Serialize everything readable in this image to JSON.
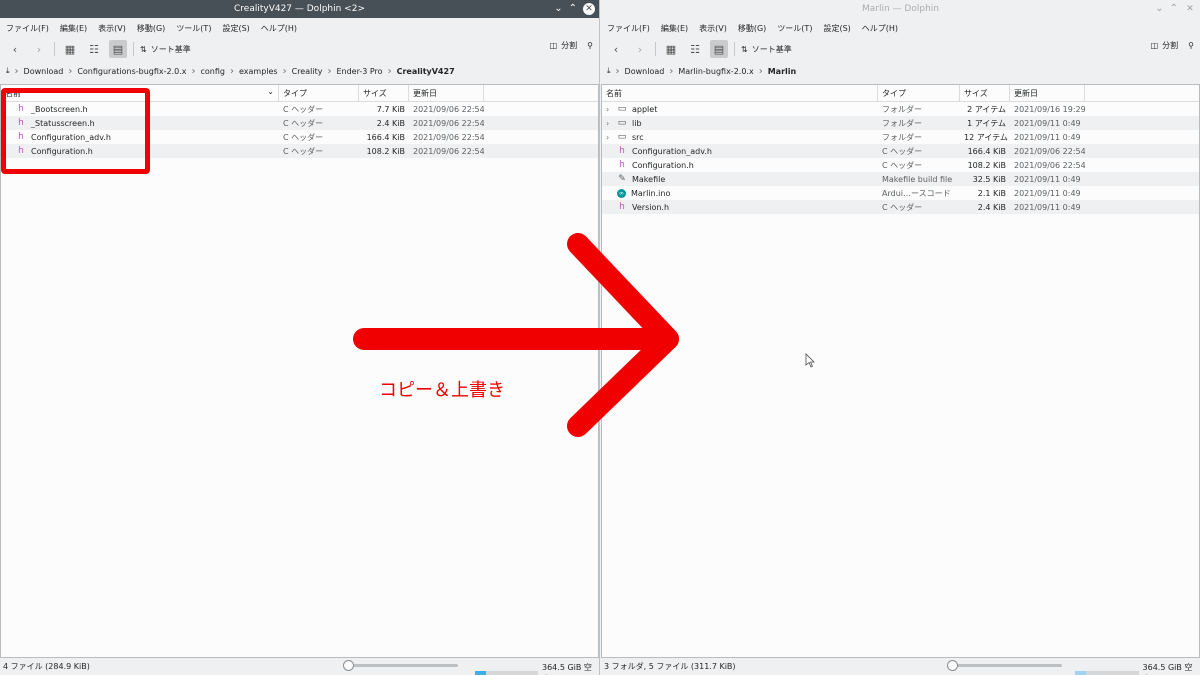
{
  "left": {
    "title": "CrealityV427 — Dolphin <2>",
    "menu": [
      "ファイル(F)",
      "編集(E)",
      "表示(V)",
      "移動(G)",
      "ツール(T)",
      "設定(S)",
      "ヘルプ(H)"
    ],
    "sort_label": "ソート基準",
    "split_label": "分割",
    "breadcrumb": [
      "Download",
      "Configurations-bugfix-2.0.x",
      "config",
      "examples",
      "Creality",
      "Ender-3 Pro"
    ],
    "breadcrumb_current": "CrealityV427",
    "columns": [
      "名前",
      "タイプ",
      "サイズ",
      "更新日"
    ],
    "files": [
      {
        "name": "_Bootscreen.h",
        "type": "C ヘッダー",
        "size": "7.7 KiB",
        "date": "2021/09/06 22:54",
        "icon": "c-header-icon"
      },
      {
        "name": "_Statusscreen.h",
        "type": "C ヘッダー",
        "size": "2.4 KiB",
        "date": "2021/09/06 22:54",
        "icon": "c-header-icon"
      },
      {
        "name": "Configuration_adv.h",
        "type": "C ヘッダー",
        "size": "166.4 KiB",
        "date": "2021/09/06 22:54",
        "icon": "c-header-icon"
      },
      {
        "name": "Configuration.h",
        "type": "C ヘッダー",
        "size": "108.2 KiB",
        "date": "2021/09/06 22:54",
        "icon": "c-header-icon"
      }
    ],
    "status": "4 ファイル (284.9 KiB)",
    "free_space": "364.5 GiB 空き",
    "space_used_fraction": 0.18,
    "space_color": "#3daee9"
  },
  "right": {
    "title": "Marlin — Dolphin",
    "menu": [
      "ファイル(F)",
      "編集(E)",
      "表示(V)",
      "移動(G)",
      "ツール(T)",
      "設定(S)",
      "ヘルプ(H)"
    ],
    "sort_label": "ソート基準",
    "split_label": "分割",
    "breadcrumb": [
      "Download",
      "Marlin-bugfix-2.0.x"
    ],
    "breadcrumb_current": "Marlin",
    "columns": [
      "名前",
      "タイプ",
      "サイズ",
      "更新日"
    ],
    "files": [
      {
        "name": "applet",
        "type": "フォルダー",
        "size": "2 アイテム",
        "date": "2021/09/16 19:29",
        "icon": "folder-icon",
        "expandable": true
      },
      {
        "name": "lib",
        "type": "フォルダー",
        "size": "1 アイテム",
        "date": "2021/09/11 0:49",
        "icon": "folder-icon",
        "expandable": true
      },
      {
        "name": "src",
        "type": "フォルダー",
        "size": "12 アイテム",
        "date": "2021/09/11 0:49",
        "icon": "folder-icon",
        "expandable": true
      },
      {
        "name": "Configuration_adv.h",
        "type": "C ヘッダー",
        "size": "166.4 KiB",
        "date": "2021/09/06 22:54",
        "icon": "c-header-icon"
      },
      {
        "name": "Configuration.h",
        "type": "C ヘッダー",
        "size": "108.2 KiB",
        "date": "2021/09/06 22:54",
        "icon": "c-header-icon"
      },
      {
        "name": "Makefile",
        "type": "Makefile build file",
        "size": "32.5 KiB",
        "date": "2021/09/11 0:49",
        "icon": "makefile-icon"
      },
      {
        "name": "Marlin.ino",
        "type": "Ardui…ースコード",
        "size": "2.1 KiB",
        "date": "2021/09/11 0:49",
        "icon": "arduino-icon"
      },
      {
        "name": "Version.h",
        "type": "C ヘッダー",
        "size": "2.4 KiB",
        "date": "2021/09/11 0:49",
        "icon": "c-header-icon"
      }
    ],
    "status": "3 フォルダ, 5 ファイル (311.7 KiB)",
    "free_space": "364.5 GiB 空き",
    "space_used_fraction": 0.18,
    "space_color": "#9ed4f1"
  },
  "annotation": {
    "caption": "コピー＆上書き",
    "color": "#f00000"
  }
}
